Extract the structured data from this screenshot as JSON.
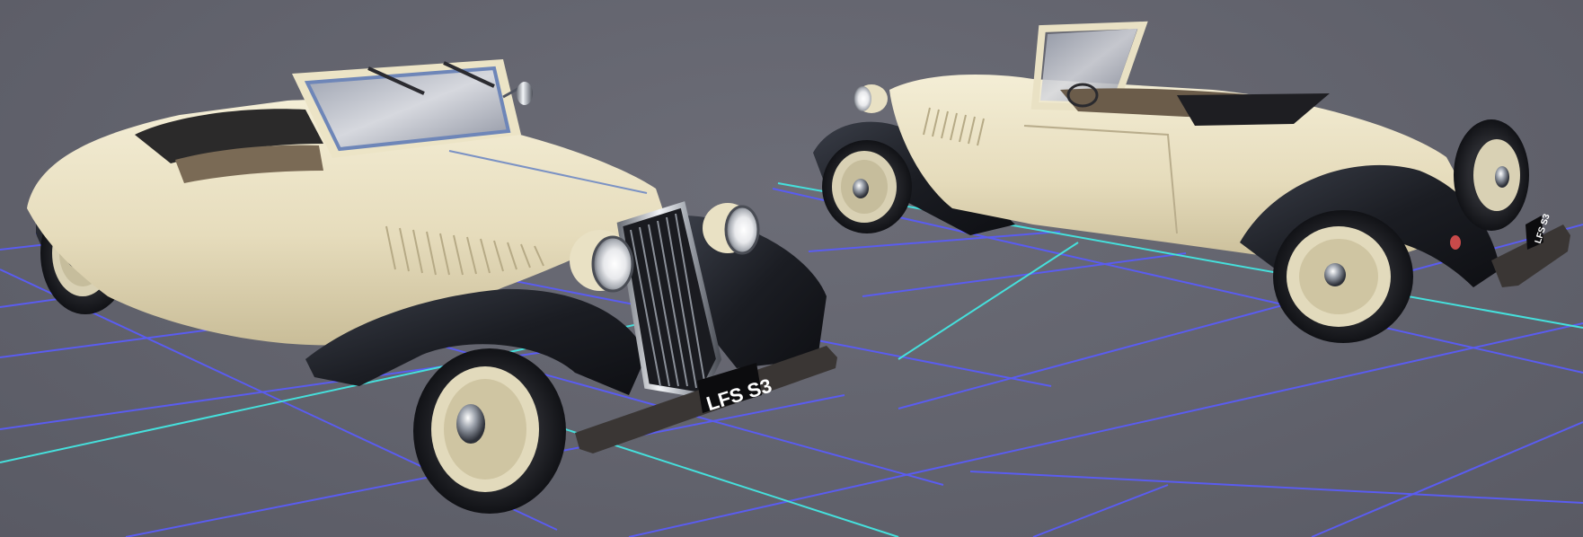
{
  "scene": {
    "background_color": "#63646e",
    "grid_color": "#5a5cf0",
    "axis_color": "#45e0dc",
    "car_body_color": "#e9e1c4",
    "fender_color": "#1c1e24",
    "chrome_color": "#c9ccd2"
  },
  "cars": [
    {
      "view": "front-three-quarter",
      "plate_text": "LFS S3"
    },
    {
      "view": "rear-three-quarter",
      "plate_text": "LFS S3"
    }
  ]
}
